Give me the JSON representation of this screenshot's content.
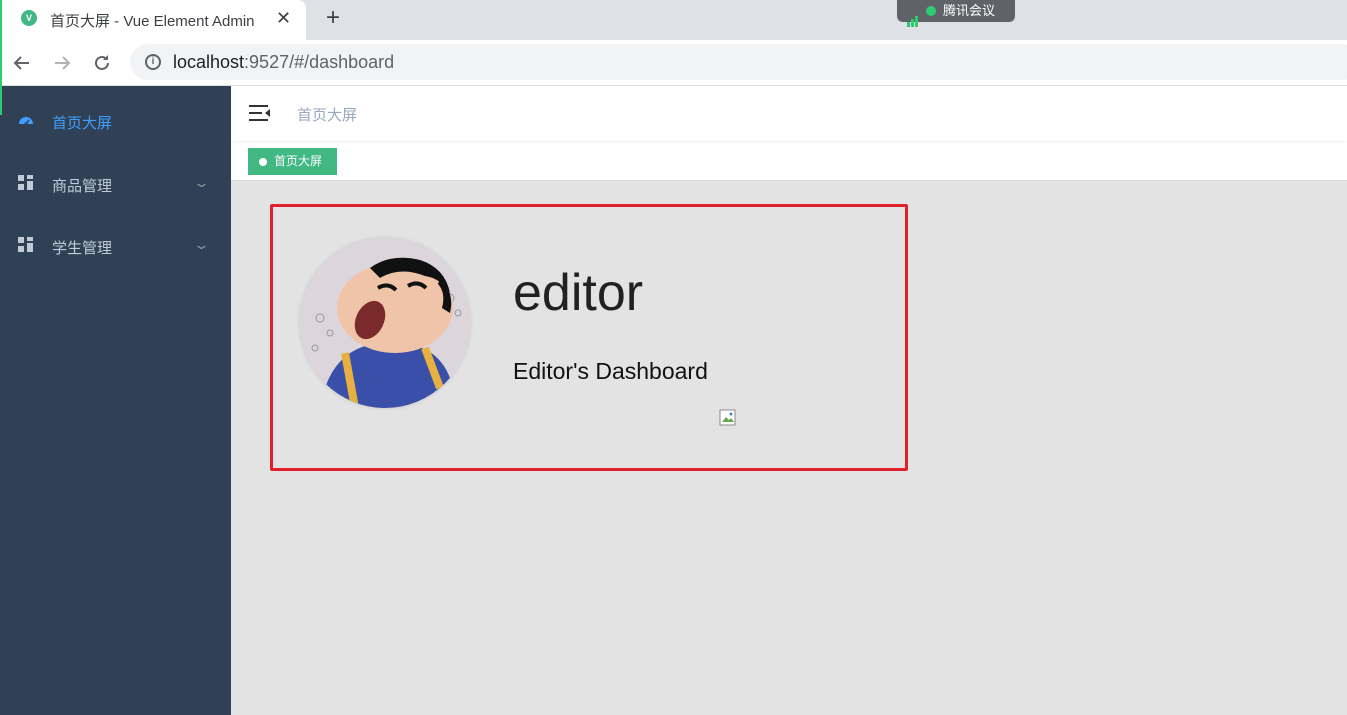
{
  "browser": {
    "tab_title": "首页大屏 - Vue Element Admin",
    "favicon_letter": "V",
    "close_glyph": "✕",
    "new_tab_glyph": "+",
    "url_host": "localhost",
    "url_rest": ":9527/#/dashboard",
    "meeting_label": "腾讯会议"
  },
  "sidebar": {
    "items": [
      {
        "label": "首页大屏",
        "icon": "dashboard-icon",
        "active": true
      },
      {
        "label": "商品管理",
        "icon": "grid-icon",
        "active": false
      },
      {
        "label": "学生管理",
        "icon": "grid-icon",
        "active": false
      }
    ]
  },
  "navbar": {
    "breadcrumb": "首页大屏"
  },
  "tags": [
    {
      "label": "首页大屏"
    }
  ],
  "dashboard": {
    "name": "editor",
    "role_title": "Editor's Dashboard"
  },
  "colors": {
    "sidebar_bg": "#304156",
    "active_menu": "#409eff",
    "tag_active": "#42b983",
    "highlight_border": "#e0202a",
    "main_bg": "#e3e3e3"
  }
}
